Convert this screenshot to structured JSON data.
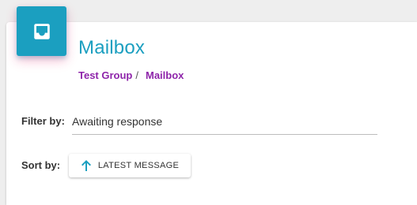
{
  "header": {
    "title": "Mailbox",
    "icon": "inbox-icon",
    "accent_color": "#1b9fc0"
  },
  "breadcrumb": {
    "items": [
      {
        "label": "Test Group",
        "separator": "/"
      },
      {
        "label": "Mailbox"
      }
    ],
    "link_color": "#8e24aa"
  },
  "filter": {
    "label": "Filter by:",
    "value": "Awaiting response"
  },
  "sort": {
    "label": "Sort by:",
    "button_label": "LATEST MESSAGE",
    "button_icon": "arrow-up-icon"
  }
}
